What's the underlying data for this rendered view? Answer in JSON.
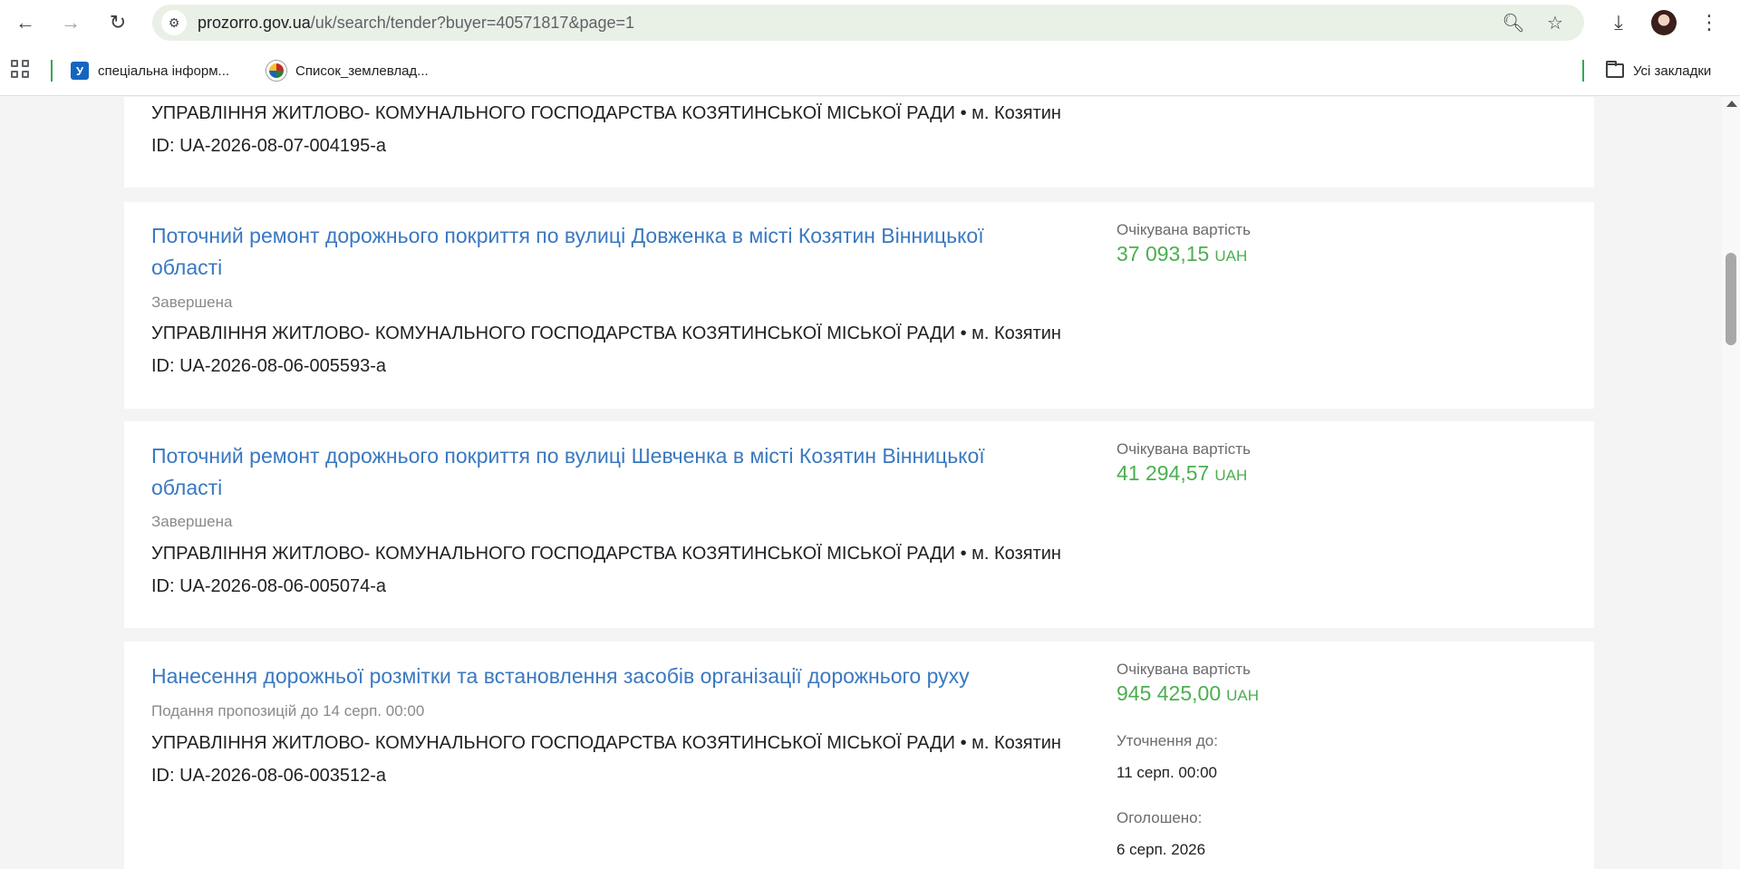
{
  "browser": {
    "url_host": "prozorro.gov.ua",
    "url_path": "/uk/search/tender?buyer=40571817&page=1",
    "bookmarks": [
      {
        "label": "спеціальна інформ...",
        "icon": "u-favicon-icon"
      },
      {
        "label": "Список_землевлад...",
        "icon": "wikipedia-icon"
      }
    ],
    "all_bookmarks_label": "Усі закладки"
  },
  "results": [
    {
      "title": "",
      "status": "",
      "buyer": "УПРАВЛІННЯ ЖИТЛОВО- КОМУНАЛЬНОГО ГОСПОДАРСТВА КОЗЯТИНСЬКОЇ МІСЬКОЇ РАДИ • м. Козятин",
      "id": "ID: UA-2026-08-07-004195-a"
    },
    {
      "title_line1": "Поточний ремонт дорожнього покриття по вулиці Довженка в місті Козятин Вінницької",
      "title_line2": "області",
      "status": "Завершена",
      "buyer": "УПРАВЛІННЯ ЖИТЛОВО- КОМУНАЛЬНОГО ГОСПОДАРСТВА КОЗЯТИНСЬКОЇ МІСЬКОЇ РАДИ • м. Козятин",
      "id": "ID: UA-2026-08-06-005593-a",
      "price_label": "Очікувана вартість",
      "price": "37 093,15",
      "currency": "UAH"
    },
    {
      "title_line1": "Поточний ремонт дорожнього покриття по вулиці Шевченка в місті Козятин Вінницької",
      "title_line2": "області",
      "status": "Завершена",
      "buyer": "УПРАВЛІННЯ ЖИТЛОВО- КОМУНАЛЬНОГО ГОСПОДАРСТВА КОЗЯТИНСЬКОЇ МІСЬКОЇ РАДИ • м. Козятин",
      "id": "ID: UA-2026-08-06-005074-a",
      "price_label": "Очікувана вартість",
      "price": "41 294,57",
      "currency": "UAH"
    },
    {
      "title_line1": "Нанесення дорожньої розмітки та встановлення засобів організації дорожнього руху",
      "status": "Подання пропозицій до 14 серп. 00:00",
      "buyer": "УПРАВЛІННЯ ЖИТЛОВО- КОМУНАЛЬНОГО ГОСПОДАРСТВА КОЗЯТИНСЬКОЇ МІСЬКОЇ РАДИ • м. Козятин",
      "id": "ID: UA-2026-08-06-003512-a",
      "price_label": "Очікувана вартість",
      "price": "945 425,00",
      "currency": "UAH",
      "clarification_label": "Уточнення до:",
      "clarification_value": "11 серп. 00:00",
      "announced_label": "Оголошено:",
      "announced_value": "6 серп. 2026"
    }
  ],
  "colors": {
    "link": "#3a78c0",
    "price": "#4caf50",
    "page_bg": "#f4f4f4"
  }
}
